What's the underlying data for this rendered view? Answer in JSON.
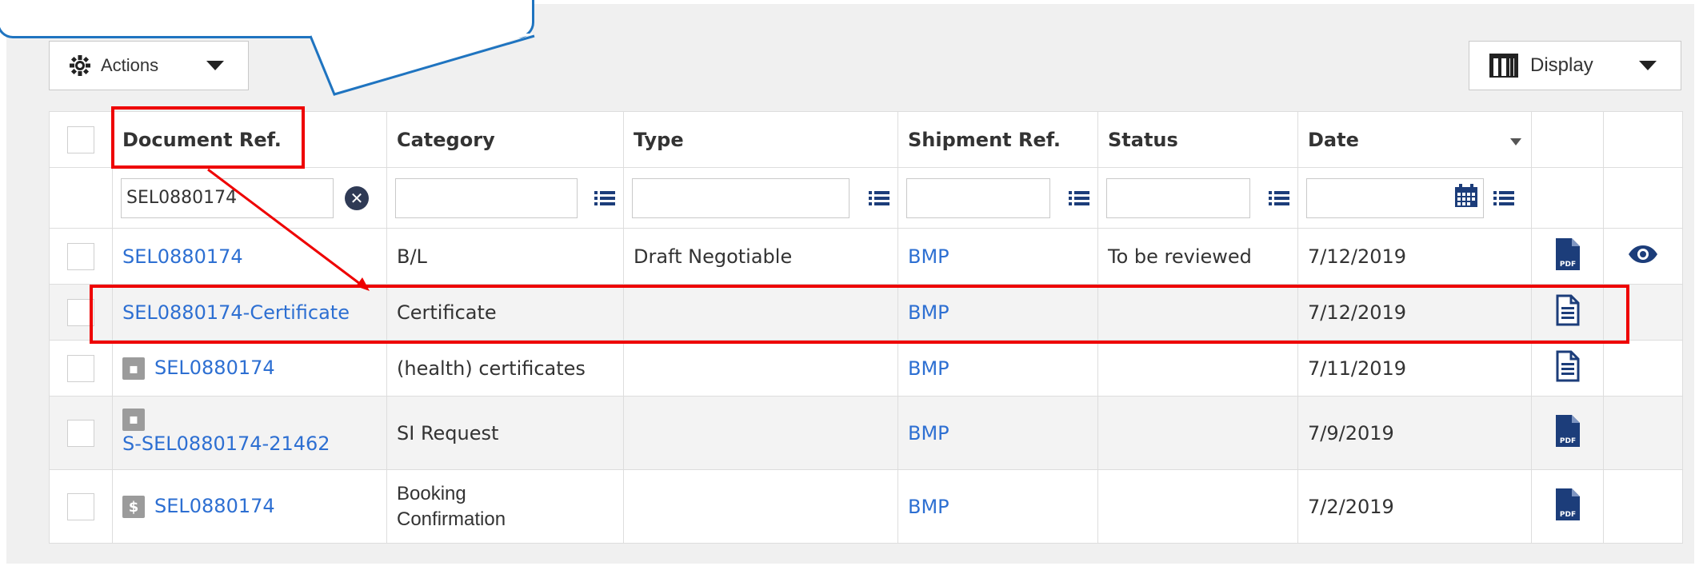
{
  "toolbar": {
    "actions_label": "Actions",
    "display_label": "Display"
  },
  "columns": {
    "document_ref": "Document Ref.",
    "category": "Category",
    "type": "Type",
    "shipment_ref": "Shipment Ref.",
    "status": "Status",
    "date": "Date"
  },
  "filters": {
    "document_ref": "SEL0880174",
    "category": "",
    "type": "",
    "shipment_ref": "",
    "status": ""
  },
  "rows": [
    {
      "document_ref": "SEL0880174",
      "category": "B/L",
      "type": "Draft Negotiable",
      "shipment_ref": "BMP",
      "status": "To be reviewed",
      "date": "7/12/2019",
      "file_icon": "pdf-icon"
    },
    {
      "document_ref": "SEL0880174-Certificate",
      "category": "Certificate",
      "type": "",
      "shipment_ref": "BMP",
      "status": "",
      "date": "7/12/2019",
      "file_icon": "document-icon"
    },
    {
      "document_ref": "SEL0880174",
      "category": "(health) certificates",
      "type": "",
      "shipment_ref": "BMP",
      "status": "",
      "date": "7/11/2019",
      "file_icon": "document-icon"
    },
    {
      "document_ref": "S-SEL0880174-21462",
      "category": "SI Request",
      "type": "",
      "shipment_ref": "BMP",
      "status": "",
      "date": "7/9/2019",
      "file_icon": "pdf-icon"
    },
    {
      "document_ref": "SEL0880174",
      "badge": "$",
      "category_line1": "Booking",
      "category_line2": "Confirmation",
      "type": "",
      "shipment_ref": "BMP",
      "status": "",
      "date": "7/2/2019",
      "file_icon": "pdf-icon"
    }
  ],
  "colors": {
    "link": "#2d6fd2",
    "highlight": "#ee0000",
    "callout_border": "#1f74c0",
    "icon_navy": "#1c3d7a"
  }
}
